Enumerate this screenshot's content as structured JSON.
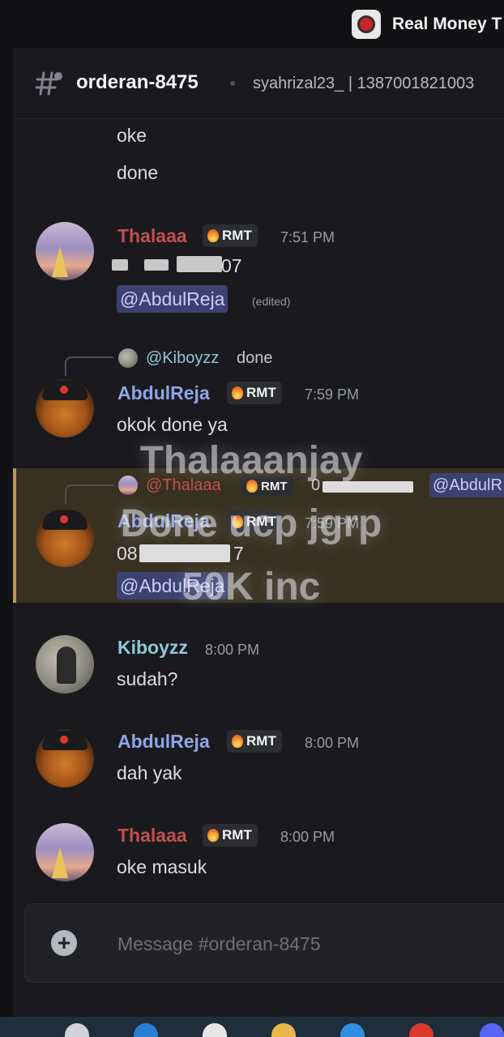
{
  "window": {
    "app_title": "Real Money T",
    "app_icon": "game-app-icon"
  },
  "header": {
    "channel_name": "orderan-8475",
    "topic": "syahrizal23_ | 1387001821003",
    "channel_icon": "thread-hash-icon"
  },
  "messages": {
    "m0": {
      "lines": [
        "oke",
        "done"
      ]
    },
    "m1": {
      "username": "Thalaaa",
      "badge": "RMT",
      "time": "7:51 PM",
      "text_suffix": "07",
      "mention": "@AbdulReja",
      "edited": "(edited)"
    },
    "m2": {
      "reply_name": "@Kiboyzz",
      "reply_text": "done",
      "username": "AbdulReja",
      "badge": "RMT",
      "time": "7:59 PM",
      "text": "okok done ya"
    },
    "m3": {
      "reply_name": "@Thalaaa",
      "reply_badge": "RMT",
      "reply_text_prefix": "0",
      "reply_mention": "@AbdulR",
      "username": "AbdulReja",
      "badge": "RMT",
      "time": "7:59 PM",
      "text_prefix": "08",
      "text_suffix": "7",
      "mention": "@AbdulReja"
    },
    "m4": {
      "username": "Kiboyzz",
      "time": "8:00 PM",
      "text": "sudah?"
    },
    "m5": {
      "username": "AbdulReja",
      "badge": "RMT",
      "time": "8:00 PM",
      "text": "dah yak"
    },
    "m6": {
      "username": "Thalaaa",
      "badge": "RMT",
      "time": "8:00 PM",
      "text": "oke masuk"
    }
  },
  "watermark": {
    "text": "Thalaaanjay\nDone ucp jgrp\n50K inc"
  },
  "composer": {
    "placeholder": "Message #orderan-8475",
    "add_icon": "plus-circle-icon"
  },
  "colors": {
    "background": "#1a1a1e",
    "thalaaa": "#c0504d",
    "abdulreja": "#8ea6e8",
    "kiboyzz": "#8ec9d8",
    "mention_bg": "#3c4270",
    "highlight_bg": "#3b3322"
  }
}
